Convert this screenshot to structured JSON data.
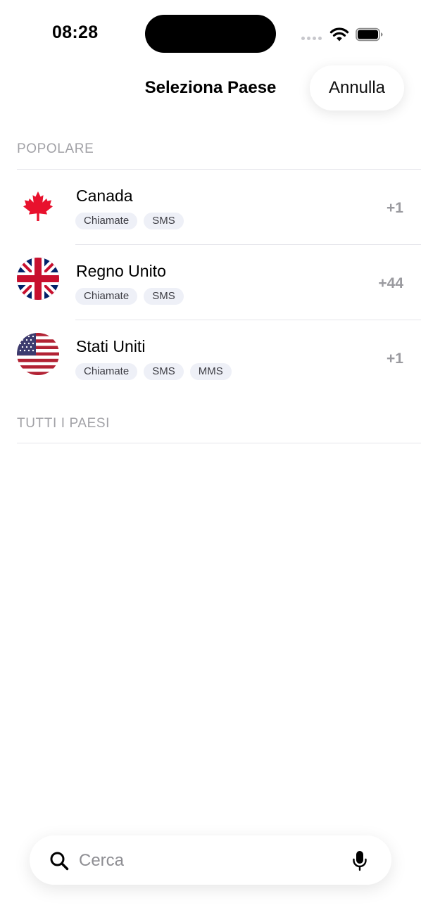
{
  "status_bar": {
    "time": "08:28"
  },
  "header": {
    "title": "Seleziona Paese",
    "cancel_label": "Annulla"
  },
  "sections": {
    "popular_label": "POPOLARE",
    "all_label": "TUTTI I PAESI"
  },
  "countries": [
    {
      "name": "Canada",
      "code": "+1",
      "flag": "canada-flag-icon",
      "tags": [
        "Chiamate",
        "SMS"
      ]
    },
    {
      "name": "Regno Unito",
      "code": "+44",
      "flag": "uk-flag-icon",
      "tags": [
        "Chiamate",
        "SMS"
      ]
    },
    {
      "name": "Stati Uniti",
      "code": "+1",
      "flag": "us-flag-icon",
      "tags": [
        "Chiamate",
        "SMS",
        "MMS"
      ]
    }
  ],
  "search": {
    "placeholder": "Cerca",
    "value": "",
    "icon": "search-icon",
    "mic_icon": "microphone-icon"
  },
  "colors": {
    "tag_bg": "#eef0f7",
    "secondary_text": "#9a9a9f",
    "divider": "#e5e5ea"
  }
}
